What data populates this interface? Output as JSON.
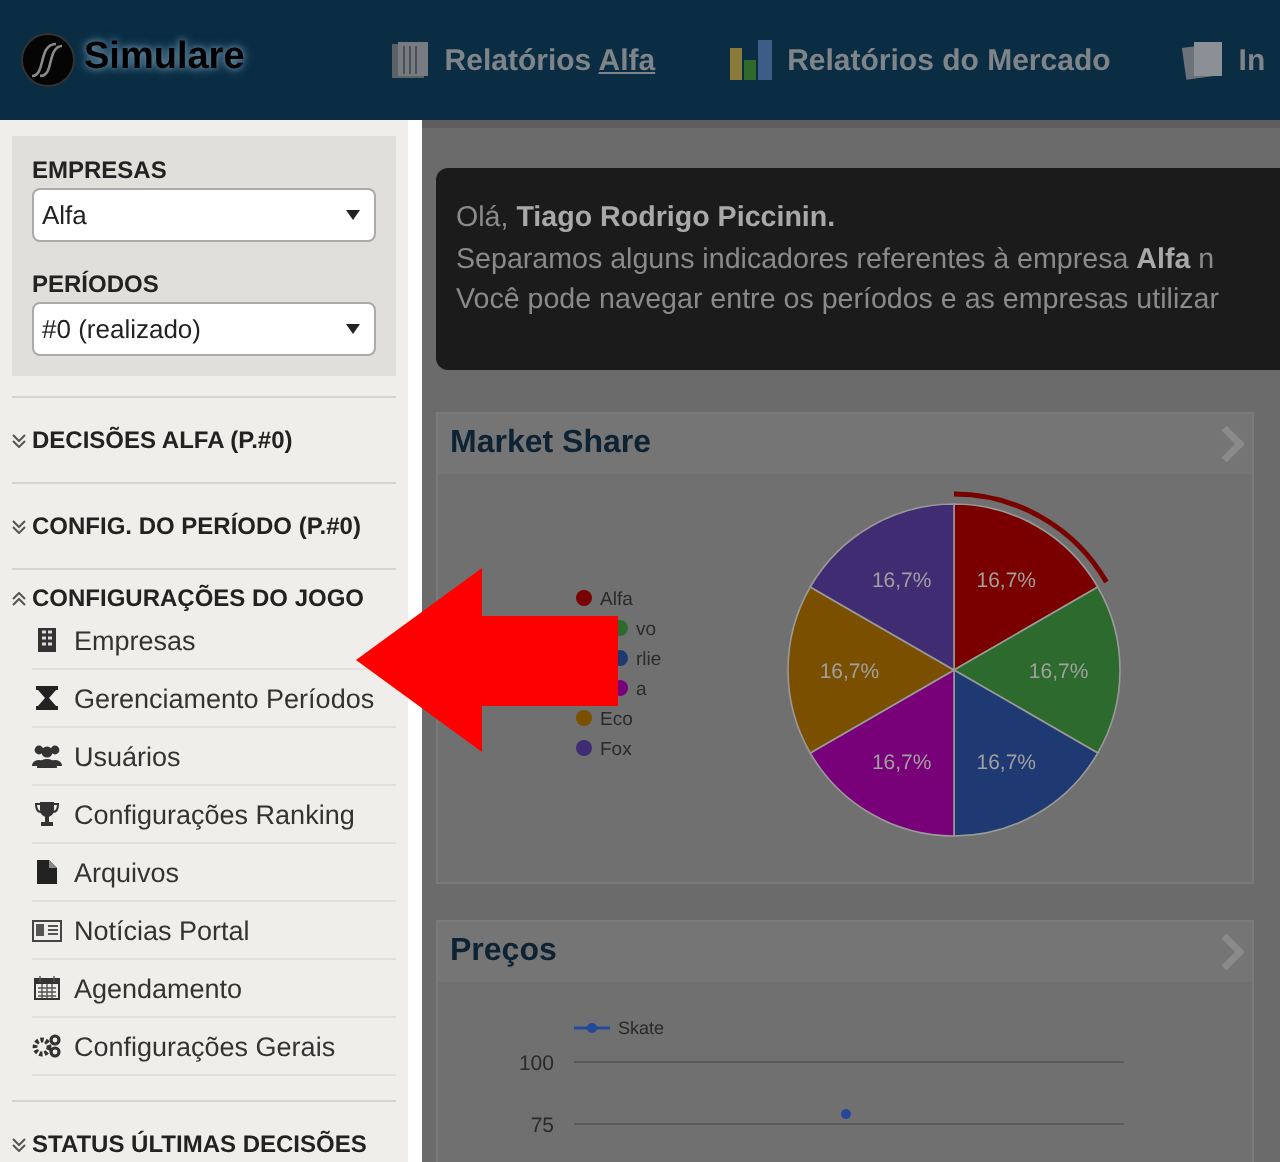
{
  "header": {
    "logo": "Simulare",
    "nav": [
      {
        "label": "Relatórios",
        "link": "Alfa"
      },
      {
        "label": "Relatórios do Mercado"
      },
      {
        "label": "In"
      }
    ]
  },
  "sidebar": {
    "filters": [
      {
        "label": "EMPRESAS",
        "value": "Alfa"
      },
      {
        "label": "PERÍODOS",
        "value": "#0 (realizado)"
      }
    ],
    "sections": [
      {
        "title": "DECISÕES ALFA (P.#0)",
        "expanded": false
      },
      {
        "title": "CONFIG. DO PERÍODO (P.#0)",
        "expanded": false
      },
      {
        "title": "CONFIGURAÇÕES DO JOGO",
        "expanded": true,
        "items": [
          "Empresas",
          "Gerenciamento Períodos",
          "Usuários",
          "Configurações Ranking",
          "Arquivos",
          "Notícias Portal",
          "Agendamento",
          "Configurações Gerais"
        ]
      },
      {
        "title": "STATUS ÚLTIMAS DECISÕES",
        "expanded": false
      }
    ]
  },
  "welcome": {
    "lines": [
      "Olá, **Tiago Rodrigo Piccinin.**",
      "Separamos alguns indicadores referentes à empresa **Alfa** n",
      "Você pode navegar entre os períodos e as empresas utilizar"
    ]
  },
  "market_share": {
    "title": "Market Share",
    "chart_data": {
      "type": "pie",
      "categories": [
        "Alfa",
        "vo",
        "rlie",
        "a",
        "Eco",
        "Fox"
      ],
      "values": [
        16.7,
        16.7,
        16.7,
        16.7,
        16.7,
        16.7
      ],
      "value_labels": [
        "16,7%",
        "16,7%",
        "16,7%",
        "16,7%",
        "16,7%",
        "16,7%"
      ],
      "colors": [
        "#7a0000",
        "#2d6a2d",
        "#1f3a72",
        "#780078",
        "#7a5000",
        "#3f2c72"
      ],
      "legend": "left"
    }
  },
  "prices": {
    "title": "Preços",
    "chart_data": {
      "type": "line",
      "series": [
        {
          "name": "Skate",
          "color": "#24479a",
          "marker": "circle",
          "values": [
            79
          ]
        }
      ],
      "ylim": [
        75,
        100
      ],
      "yticks": [
        100,
        75
      ],
      "legend": "top"
    }
  }
}
